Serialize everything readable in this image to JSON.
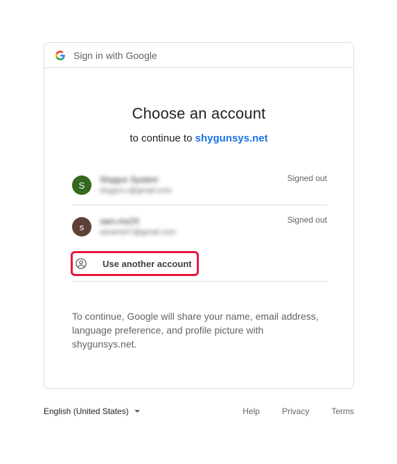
{
  "header": {
    "title": "Sign in with Google"
  },
  "main": {
    "title": "Choose an account",
    "subtitle_prefix": "to continue to",
    "site": "shygunsys.net",
    "accounts": [
      {
        "initial": "S",
        "name": "Shygun System",
        "email": "shygun.r@gmail.com",
        "status": "Signed out",
        "color": "#33691e"
      },
      {
        "initial": "s",
        "name": "saro.ms2X",
        "email": "saramsh7@gmail.com",
        "status": "Signed out",
        "color": "#5d4037"
      }
    ],
    "use_another": "Use another account",
    "info": "To continue, Google will share your name, email address, language preference, and profile picture with shygunsys.net."
  },
  "footer": {
    "language": "English (United States)",
    "links": [
      "Help",
      "Privacy",
      "Terms"
    ]
  },
  "colors": {
    "accent": "#1a73e8",
    "highlight": "#e5163e"
  }
}
